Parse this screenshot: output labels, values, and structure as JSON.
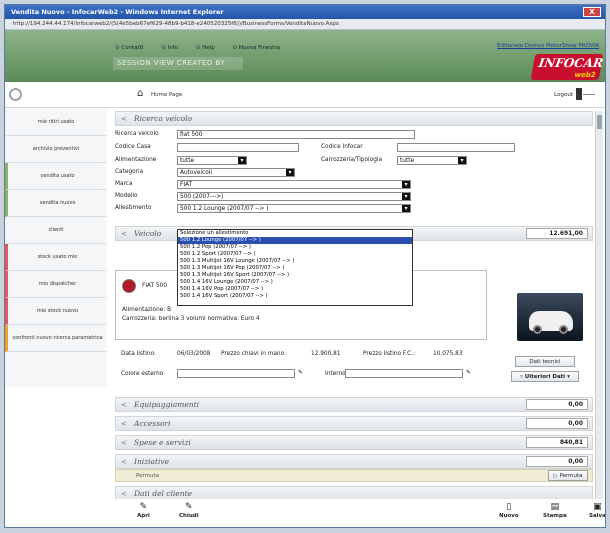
{
  "window": {
    "title": "Vendita Nuovo - InfocarWeb2 - Windows Internet Explorer",
    "url": "http://194.244.44.174/infocarweb2/(S(4e5beb67ef629-48b9-b418-e240520325f6))/BusinessForms/VenditaNuovo.Aspx",
    "close": "X"
  },
  "banner": {
    "links": [
      "ContattI",
      "Info",
      "Help",
      "Nuova Finestra"
    ],
    "session": "SESSION VIEW CREATED BY",
    "editorial": "Editoriale Domus MotorShow PROVIA",
    "logo_main": "INFOCAR",
    "logo_sub": "web2"
  },
  "nav": {
    "home": "Home Page",
    "logout": "Logout"
  },
  "sidebar": [
    {
      "label": "mie ritiri usato",
      "accent": "none"
    },
    {
      "label": "archivio preventivi",
      "accent": "none"
    },
    {
      "label": "vendita usato",
      "accent": "green"
    },
    {
      "label": "vendita nuovo",
      "accent": "green"
    },
    {
      "label": "clienti",
      "accent": "none"
    },
    {
      "label": "stock usato mio",
      "accent": "red"
    },
    {
      "label": "mio dispatcher",
      "accent": "red"
    },
    {
      "label": "mie stock nuovo",
      "accent": "red"
    },
    {
      "label": "confronti nuovo ricerca parametrica",
      "accent": "orange"
    }
  ],
  "ricerca": {
    "title": "Ricerca veicolo",
    "ricerca_label": "Ricerca veicolo",
    "ricerca_value": "fiat 500",
    "codice_casa_label": "Codice Casa",
    "codice_infocar_label": "Codice Infocar",
    "alimentazione_label": "Alimentazione",
    "alimentazione_value": "tutte",
    "carrozzeria_label": "Carrozzeria/Tipologia",
    "carrozzeria_value": "tutte",
    "categoria_label": "Categoria",
    "categoria_value": "Autoveicoli",
    "marca_label": "Marca",
    "marca_value": "FIAT",
    "modello_label": "Modello",
    "modello_value": "500 (2007--->)",
    "allestimento_label": "Allestimento",
    "allestimento_value": "500 1.2 Lounge (2007/07 --> )"
  },
  "dropdown": [
    "Selezione un allestimento",
    "500 1.2 Lounge (2007/07 --> )",
    "500 1.2 Pop (2007/07 --> )",
    "500 1.2 Sport (2007/07 --> )",
    "500 1.3 Multijet 16V Lounge (2007/07 --> )",
    "500 1.3 Multijet 16V Pop (2007/07 --> )",
    "500 1.3 Multijet 16V Sport (2007/07 --> )",
    "500 1.4 16V Lounge (2007/07 --> )",
    "500 1.4 16V Pop (2007/07 --> )",
    "500 1.4 16V Sport (2007/07 --> )"
  ],
  "veicolo": {
    "title": "Veicolo",
    "price": "12.691,00",
    "name": "FIAT 500",
    "alimentazione": "Alimentazione: B",
    "carrozzeria": "Carrozzeria: berlina 3 volumi normativa: Euro 4"
  },
  "prezzi": {
    "listino_label": "Data listino:",
    "listino_value": "06/03/2008",
    "chiavi_label": "Prezzo chiavi in mano:",
    "chiavi_value": "12.900,81",
    "fc_label": "Prezzo listino F.C.:",
    "fc_value": "10.075,83",
    "colore_label": "Colore esterno",
    "interno_label": "Interno",
    "dati_tecnici": "Dati tecnici",
    "ulteriori": "Ulteriori Dati"
  },
  "sections": [
    {
      "title": "Equipaggiamenti",
      "value": "0,00"
    },
    {
      "title": "Accessori",
      "value": "0,00"
    },
    {
      "title": "Spese e servizi",
      "value": "840,81"
    },
    {
      "title": "Iniziative",
      "value": "0,00"
    }
  ],
  "permuta": {
    "label": "Permuta",
    "button": "Permuta"
  },
  "dati_cliente": "Dati del cliente",
  "bottom": {
    "apri": "Apri",
    "chiudi": "Chiudi",
    "nuovo": "Nuovo",
    "stampa": "Stampa",
    "salva": "Salva"
  }
}
